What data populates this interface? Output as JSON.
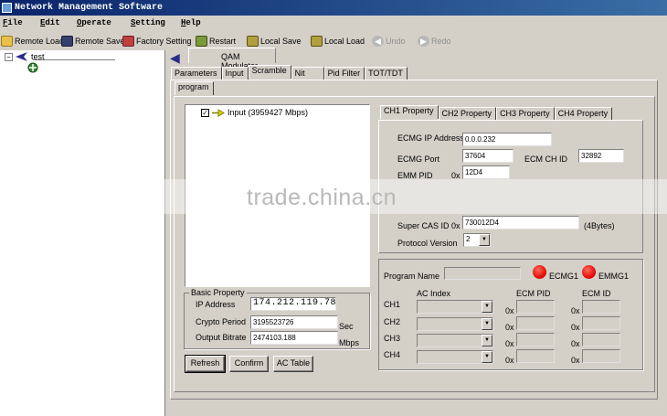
{
  "window": {
    "title": "Network Management Software"
  },
  "menu": [
    "File",
    "Edit",
    "Operate",
    "Setting",
    "Help"
  ],
  "toolbar": {
    "remote_load": "Remote Load",
    "remote_save": "Remote Save",
    "factory_setting": "Factory Setting",
    "restart": "Restart",
    "local_save": "Local Save",
    "local_load": "Local Load",
    "undo": "Undo",
    "redo": "Redo"
  },
  "tree": {
    "root_label": "test"
  },
  "module": {
    "name": "QAM Modulator"
  },
  "tabs": [
    "Parameters",
    "Input",
    "Scramble",
    "Nit",
    "Pid Filter",
    "TOT/TDT"
  ],
  "active_tab": "Scramble",
  "subtab": "program",
  "program_tree": {
    "input_label": "Input (3959427 Mbps)"
  },
  "basic_property": {
    "title": "Basic Property",
    "ip_label": "IP Address",
    "ip_value": "174.212.119.78",
    "crypto_label": "Crypto Period",
    "crypto_value": "3195523726",
    "crypto_unit": "Sec",
    "bitrate_label": "Output Bitrate",
    "bitrate_value": "2474103.188",
    "bitrate_unit": "Mbps"
  },
  "buttons": {
    "refresh": "Refresh",
    "confirm": "Confirm",
    "ac_table": "AC Table"
  },
  "ch_tabs": [
    "CH1 Property",
    "CH2 Property",
    "CH3 Property",
    "CH4 Property"
  ],
  "ch1": {
    "ecmg_ip_label": "ECMG IP Address",
    "ecmg_ip_value": "0.0.0.232",
    "ecmg_port_label": "ECMG Port",
    "ecmg_port_value": "37604",
    "ecm_ch_id_label": "ECM CH ID",
    "ecm_ch_id_value": "32892",
    "emm_pid_label": "EMM PID",
    "hex_prefix": "0x",
    "emm_pid_value": "12D4",
    "super_cas_label": "Super CAS ID",
    "super_cas_value": "730012D4",
    "super_cas_unit": "(4Bytes)",
    "protocol_label": "Protocol Version",
    "protocol_value": "2"
  },
  "program_section": {
    "program_name_label": "Program Name",
    "ecmg_status": "ECMG1",
    "emmg_status": "EMMG1",
    "status_color": "#e00000",
    "col_ac_index": "AC Index",
    "col_ecm_pid": "ECM PID",
    "col_ecm_id": "ECM ID",
    "rows": [
      "CH1",
      "CH2",
      "CH3",
      "CH4"
    ],
    "hex_prefix": "0x"
  },
  "watermark": "trade.china.cn"
}
